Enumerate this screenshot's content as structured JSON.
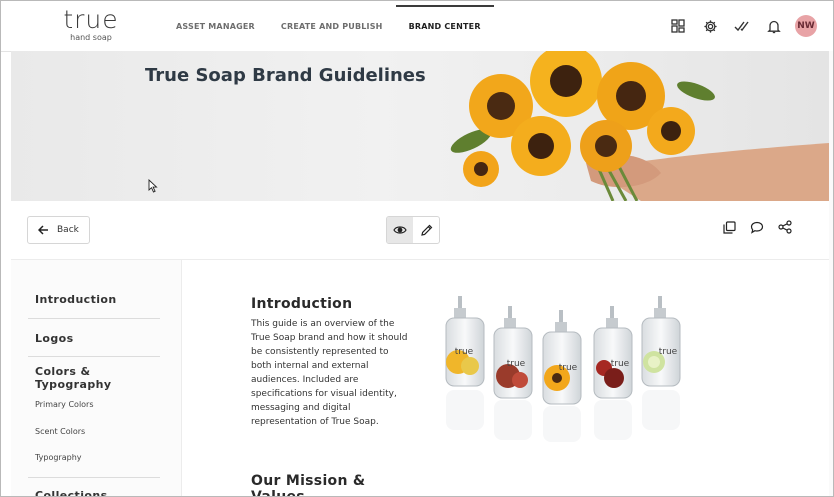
{
  "brand": {
    "logo_main": "true",
    "logo_sub": "hand soap"
  },
  "nav": [
    {
      "label": "ASSET MANAGER",
      "active": false
    },
    {
      "label": "CREATE AND PUBLISH",
      "active": false
    },
    {
      "label": "BRAND CENTER",
      "active": true
    }
  ],
  "header_icons": [
    "apps-grid-icon",
    "gear-icon",
    "double-check-icon",
    "bell-icon"
  ],
  "user": {
    "initials": "NW",
    "avatar_color": "#e8a3a6"
  },
  "hero": {
    "title": "True Soap Brand Guidelines"
  },
  "toolbar": {
    "back_label": "Back",
    "view_modes": [
      "eye-icon",
      "pencil-icon"
    ],
    "active_mode": "eye-icon",
    "actions": [
      "copy-icon",
      "comment-icon",
      "share-icon"
    ]
  },
  "sidebar": {
    "sections": [
      {
        "label": "Introduction",
        "items": []
      },
      {
        "label": "Logos",
        "items": []
      },
      {
        "label": "Colors & Typography",
        "items": [
          "Primary Colors",
          "Scent Colors",
          "Typography"
        ]
      },
      {
        "label": "Collections",
        "items": []
      }
    ]
  },
  "content": {
    "intro_title": "Introduction",
    "intro_body": "This guide is an overview of the True Soap brand and how it should be consistently represented to both internal and external audiences. Included are specifications for visual identity, messaging and digital representation of True Soap.",
    "mission_title": "Our Mission & Values",
    "product_label": "true"
  }
}
